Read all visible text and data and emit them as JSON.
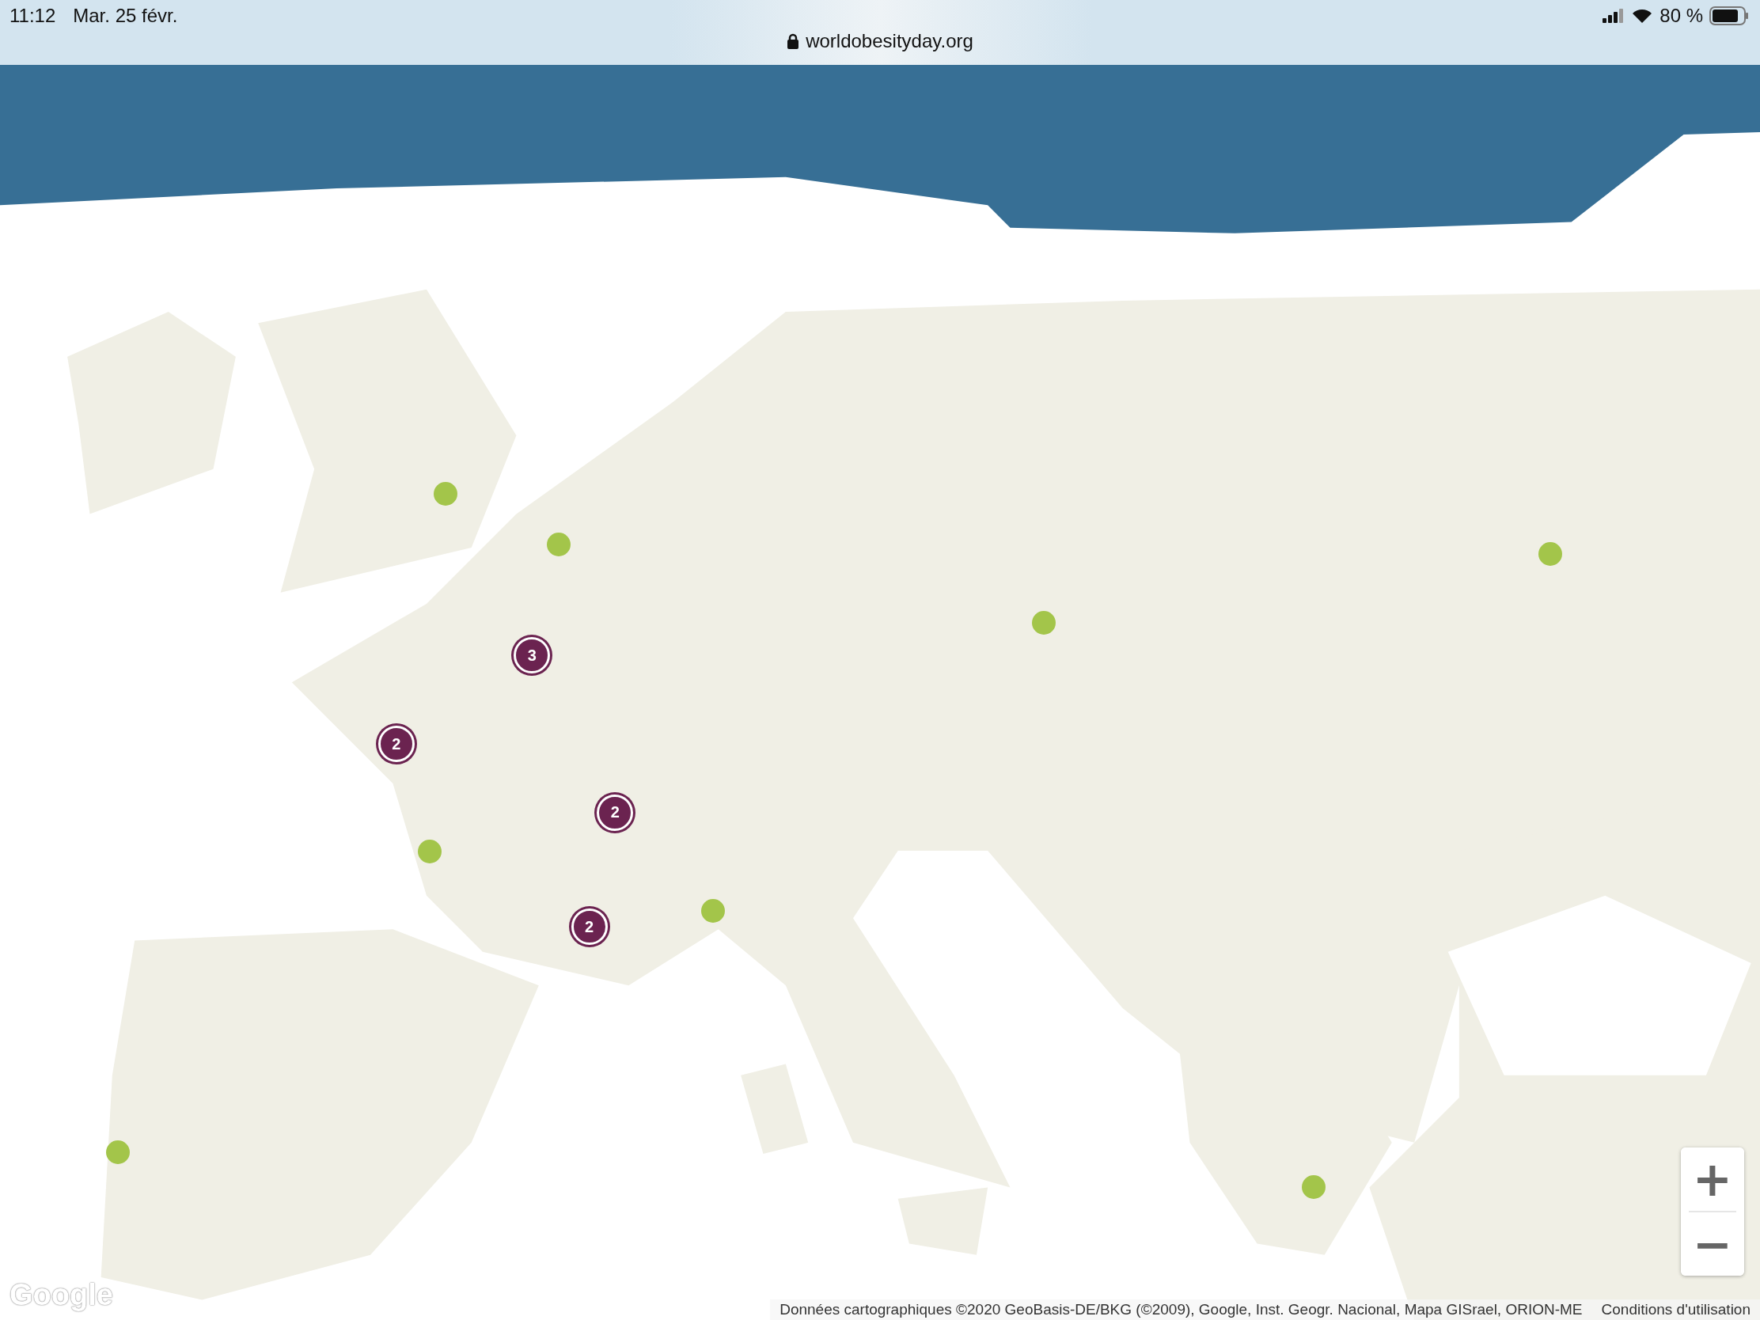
{
  "status_bar": {
    "time": "11:12",
    "date": "Mar. 25 févr.",
    "url": "worldobesityday.org",
    "battery": "80 %"
  },
  "map": {
    "kind": "picture",
    "markers": [
      {
        "kind": "dot"
      },
      {
        "kind": "dot"
      },
      {
        "kind": "dot"
      },
      {
        "kind": "dot"
      },
      {
        "kind": "dot"
      },
      {
        "kind": "dot"
      },
      {
        "kind": "dot"
      },
      {
        "kind": "dot"
      },
      {
        "kind": "cluster",
        "count": "3"
      },
      {
        "kind": "cluster",
        "count": "2"
      },
      {
        "kind": "cluster",
        "count": "2"
      },
      {
        "kind": "cluster",
        "count": "2"
      }
    ],
    "zoom_in": "+",
    "zoom_out": "−",
    "logo": "Google",
    "attribution": "Données cartographiques ©2020 GeoBasis-DE/BKG (©2009), Google, Inst. Geogr. Nacional, Mapa GISrael, ORION-ME",
    "terms": "Conditions d'utilisation"
  }
}
